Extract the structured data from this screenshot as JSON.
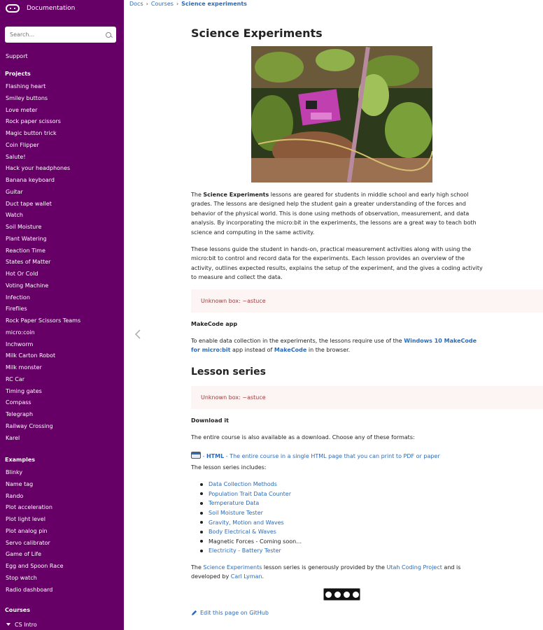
{
  "app": {
    "brand_title": "Documentation"
  },
  "search": {
    "placeholder": "Search..."
  },
  "sidebar": {
    "support": "Support",
    "projects_heading": "Projects",
    "projects": [
      "Flashing heart",
      "Smiley buttons",
      "Love meter",
      "Rock paper scissors",
      "Magic button trick",
      "Coin Flipper",
      "Salute!",
      "Hack your headphones",
      "Banana keyboard",
      "Guitar",
      "Duct tape wallet",
      "Watch",
      "Soil Moisture",
      "Plant Watering",
      "Reaction Time",
      "States of Matter",
      "Hot Or Cold",
      "Voting Machine",
      "Infection",
      "Fireflies",
      "Rock Paper Scissors Teams",
      "micro:coin",
      "Inchworm",
      "Milk Carton Robot",
      "Milk monster",
      "RC Car",
      "Timing gates",
      "Compass",
      "Telegraph",
      "Railway Crossing",
      "Karel"
    ],
    "examples_heading": "Examples",
    "examples": [
      "Blinky",
      "Name tag",
      "Rando",
      "Plot acceleration",
      "Plot light level",
      "Plot analog pin",
      "Servo calibrator",
      "Game of Life",
      "Egg and Spoon Race",
      "Stop watch",
      "Radio dashboard"
    ],
    "courses_heading": "Courses",
    "courses": [
      "CS Intro"
    ]
  },
  "breadcrumb": {
    "items": [
      "Docs",
      "Courses"
    ],
    "current": "Science experiments"
  },
  "main": {
    "title": "Science Experiments",
    "intro_p1": {
      "pre": "The ",
      "bold": "Science Experiments",
      "line1_rest": " lessons are geared for students in middle school and early high school",
      "line2": "grades. The lessons are designed help the student gain a greater understanding of the forces and",
      "line3": "behavior of the physical world. This is done using methods of observation, measurement, and data",
      "line4": "analysis. By incorporating the micro:bit in the experiments, the lessons are a great way to teach both",
      "line5": "science and computing in the same activity."
    },
    "intro_p2": {
      "line1": "These lessons guide the student in hands-on, practical measurement activities along with using the",
      "line2": "micro:bit to control and record data for the experiments. Each lesson provides an overview of the",
      "line3": "activity, outlines expected results, explains the setup of the experiment, and the gives a coding activity",
      "line4": "to measure and collect the data."
    },
    "unknown_box_1": "Unknown box: ~astuce",
    "makecode_heading": "MakeCode app",
    "makecode_p": {
      "pre": "To enable data collection in the experiments, the lessons require use of the ",
      "link1_line1": "Windows 10 MakeCode",
      "link1_line2": "for micro:bit",
      "mid": " app instead of ",
      "link2": "MakeCode",
      "post": " in the browser."
    },
    "lesson_series_heading": "Lesson series",
    "unknown_box_2": "Unknown box: ~astuce",
    "download_heading": "Download it",
    "download_p": "The entire course is also available as a download. Choose any of these formats:",
    "download_link": {
      "dash": " - ",
      "label": "HTML",
      "description": " - The entire course in a single HTML page that you can print to PDF or paper"
    },
    "series_intro": "The lesson series includes:",
    "lessons": [
      {
        "label": "Data Collection Methods",
        "link": true
      },
      {
        "label": "Population Trait Data Counter",
        "link": true
      },
      {
        "label": "Temperature Data",
        "link": true
      },
      {
        "label": "Soil Moisture Tester",
        "link": true
      },
      {
        "label": "Gravity, Motion and Waves",
        "link": true
      },
      {
        "label": "Body Electrical & Waves",
        "link": true
      },
      {
        "label": "Magnetic Forces - Coming soon…",
        "link": false
      },
      {
        "label": "Electricity - Battery Tester",
        "link": true
      }
    ],
    "credit": {
      "pre": "The ",
      "link1": "Science Experiments",
      "mid1": " lesson series is generously provided by the ",
      "link2": "Utah Coding Project",
      "mid2": " and is",
      "line2_pre": "developed by ",
      "link3": "Carl Lyman",
      "line2_post": "."
    },
    "edit_link": "Edit this page on GitHub"
  }
}
